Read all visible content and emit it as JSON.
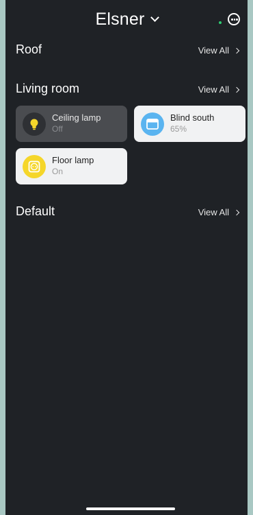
{
  "header": {
    "title": "Elsner"
  },
  "sections": [
    {
      "title": "Roof",
      "view_all": "View All"
    },
    {
      "title": "Living room",
      "view_all": "View All"
    },
    {
      "title": "Default",
      "view_all": "View All"
    }
  ],
  "devices": [
    {
      "name": "Ceiling lamp",
      "state": "Off",
      "icon": "bulb-icon"
    },
    {
      "name": "Blind south",
      "state": "65%",
      "icon": "blind-icon"
    },
    {
      "name": "Floor lamp",
      "state": "On",
      "icon": "socket-icon"
    }
  ],
  "colors": {
    "background": "#1f2226",
    "tile_off": "#4a4c50",
    "tile_on": "#f1f2f3",
    "blind_accent": "#5ab4f0",
    "lamp_accent": "#f5d62a",
    "status_dot": "#2ecc71"
  }
}
